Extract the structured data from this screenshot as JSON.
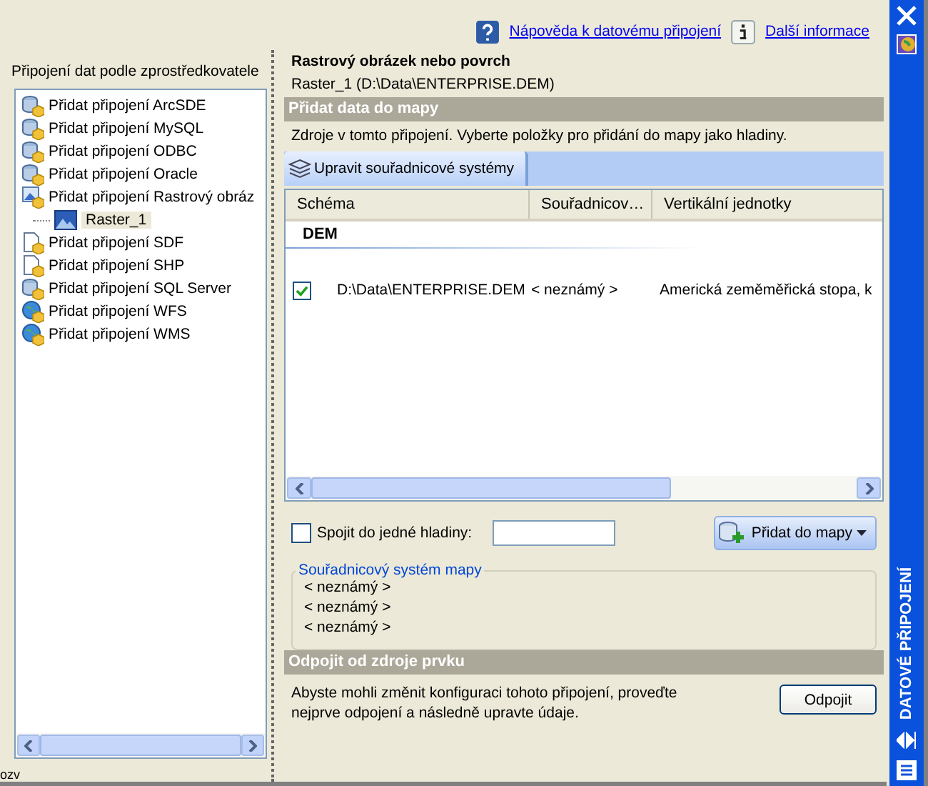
{
  "left_panel": {
    "title": "Připojení dat podle zprostředkovatele",
    "tree": [
      {
        "label": "Přidat připojení ArcSDE",
        "kind": "db",
        "selected": false
      },
      {
        "label": "Přidat připojení MySQL",
        "kind": "db",
        "selected": false
      },
      {
        "label": "Přidat připojení ODBC",
        "kind": "db",
        "selected": false
      },
      {
        "label": "Přidat připojení Oracle",
        "kind": "db",
        "selected": false
      },
      {
        "label": "Přidat připojení Rastrový obráz",
        "kind": "raster",
        "selected": false,
        "children": [
          {
            "label": "Raster_1",
            "kind": "image",
            "selected": true
          }
        ]
      },
      {
        "label": "Přidat připojení SDF",
        "kind": "file",
        "selected": false
      },
      {
        "label": "Přidat připojení SHP",
        "kind": "file",
        "selected": false
      },
      {
        "label": "Přidat připojení SQL Server",
        "kind": "db",
        "selected": false
      },
      {
        "label": "Přidat připojení WFS",
        "kind": "globe",
        "selected": false
      },
      {
        "label": "Přidat připojení WMS",
        "kind": "globe",
        "selected": false
      }
    ],
    "status_fragment": "ozv"
  },
  "links": [
    "Nápověda k datovému připojení",
    "Další informace"
  ],
  "heading": "Rastrový obrázek nebo povrch",
  "subheading": "Raster_1 (D:\\Data\\ENTERPRISE.DEM)",
  "add_section": {
    "title": "Přidat data do mapy",
    "description": "Zdroje v tomto připojení. Vyberte položky pro přidání do mapy jako hladiny.",
    "toolbar_button": "Upravit souřadnicové systémy",
    "table": {
      "columns": [
        "Schéma",
        "Souřadnicov…",
        "Vertikální jednotky"
      ],
      "group": "DEM",
      "rows": [
        {
          "checked": true,
          "cells": [
            "D:\\Data\\ENTERPRISE.DEM",
            "< neznámý >",
            "Americká zeměměřická stopa, k"
          ]
        }
      ]
    },
    "merge": {
      "checked": false,
      "label": "Spojit do jedné hladiny:"
    },
    "add_button": "Přidat do mapy",
    "crs_group": {
      "title": "Souřadnicový systém mapy",
      "lines": [
        "< neznámý >",
        "< neznámý >",
        "< neznámý >"
      ]
    }
  },
  "disconnect_section": {
    "title": "Odpojit od zdroje prvku",
    "description": "Abyste mohli změnit konfiguraci tohoto připojení, proveďte nejprve odpojení a následně upravte údaje.",
    "button": "Odpojit"
  },
  "side_strip": {
    "title": "DATOVÉ PŘIPOJENÍ"
  }
}
